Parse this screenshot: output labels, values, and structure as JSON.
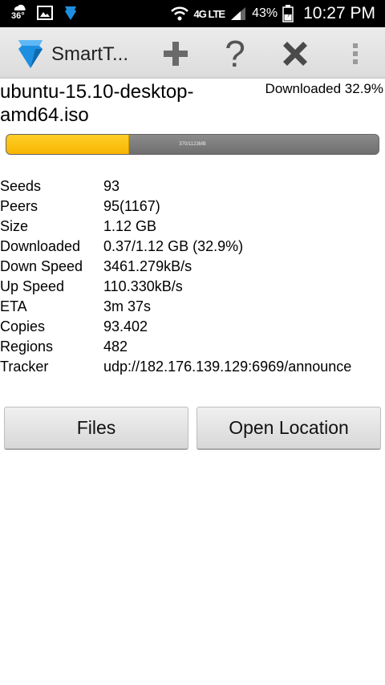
{
  "status_bar": {
    "temperature": "36°",
    "network": "4G LTE",
    "battery": "43%",
    "time": "10:27 PM",
    "icons": [
      "weather-icon",
      "image-icon",
      "app-icon",
      "wifi-icon",
      "lte-icon",
      "signal-icon",
      "battery-icon"
    ]
  },
  "action_bar": {
    "title": "SmartT...",
    "actions": [
      "add-icon",
      "help-icon",
      "close-icon",
      "overflow-menu-icon"
    ]
  },
  "torrent": {
    "name": "ubuntu-15.10-desktop-amd64.iso",
    "status": "Downloaded 32.9%",
    "progress_fraction": 0.329,
    "progress_label": "370/1123MB"
  },
  "details": [
    {
      "label": "Seeds",
      "value": "93"
    },
    {
      "label": "Peers",
      "value": "95(1167)"
    },
    {
      "label": "Size",
      "value": "1.12 GB"
    },
    {
      "label": "Downloaded",
      "value": "0.37/1.12 GB (32.9%)"
    },
    {
      "label": "Down Speed",
      "value": "3461.279kB/s"
    },
    {
      "label": "Up Speed",
      "value": "110.330kB/s"
    },
    {
      "label": "ETA",
      "value": "3m 37s"
    },
    {
      "label": "Copies",
      "value": "93.402"
    },
    {
      "label": "Regions",
      "value": "482"
    },
    {
      "label": "Tracker",
      "value": "udp://182.176.139.129:6969/announce"
    }
  ],
  "buttons": {
    "files": "Files",
    "open_location": "Open Location"
  },
  "colors": {
    "progress_fill": "#f7b500",
    "progress_track": "#7a7a7a",
    "app_icon": "#1e8fe0"
  }
}
